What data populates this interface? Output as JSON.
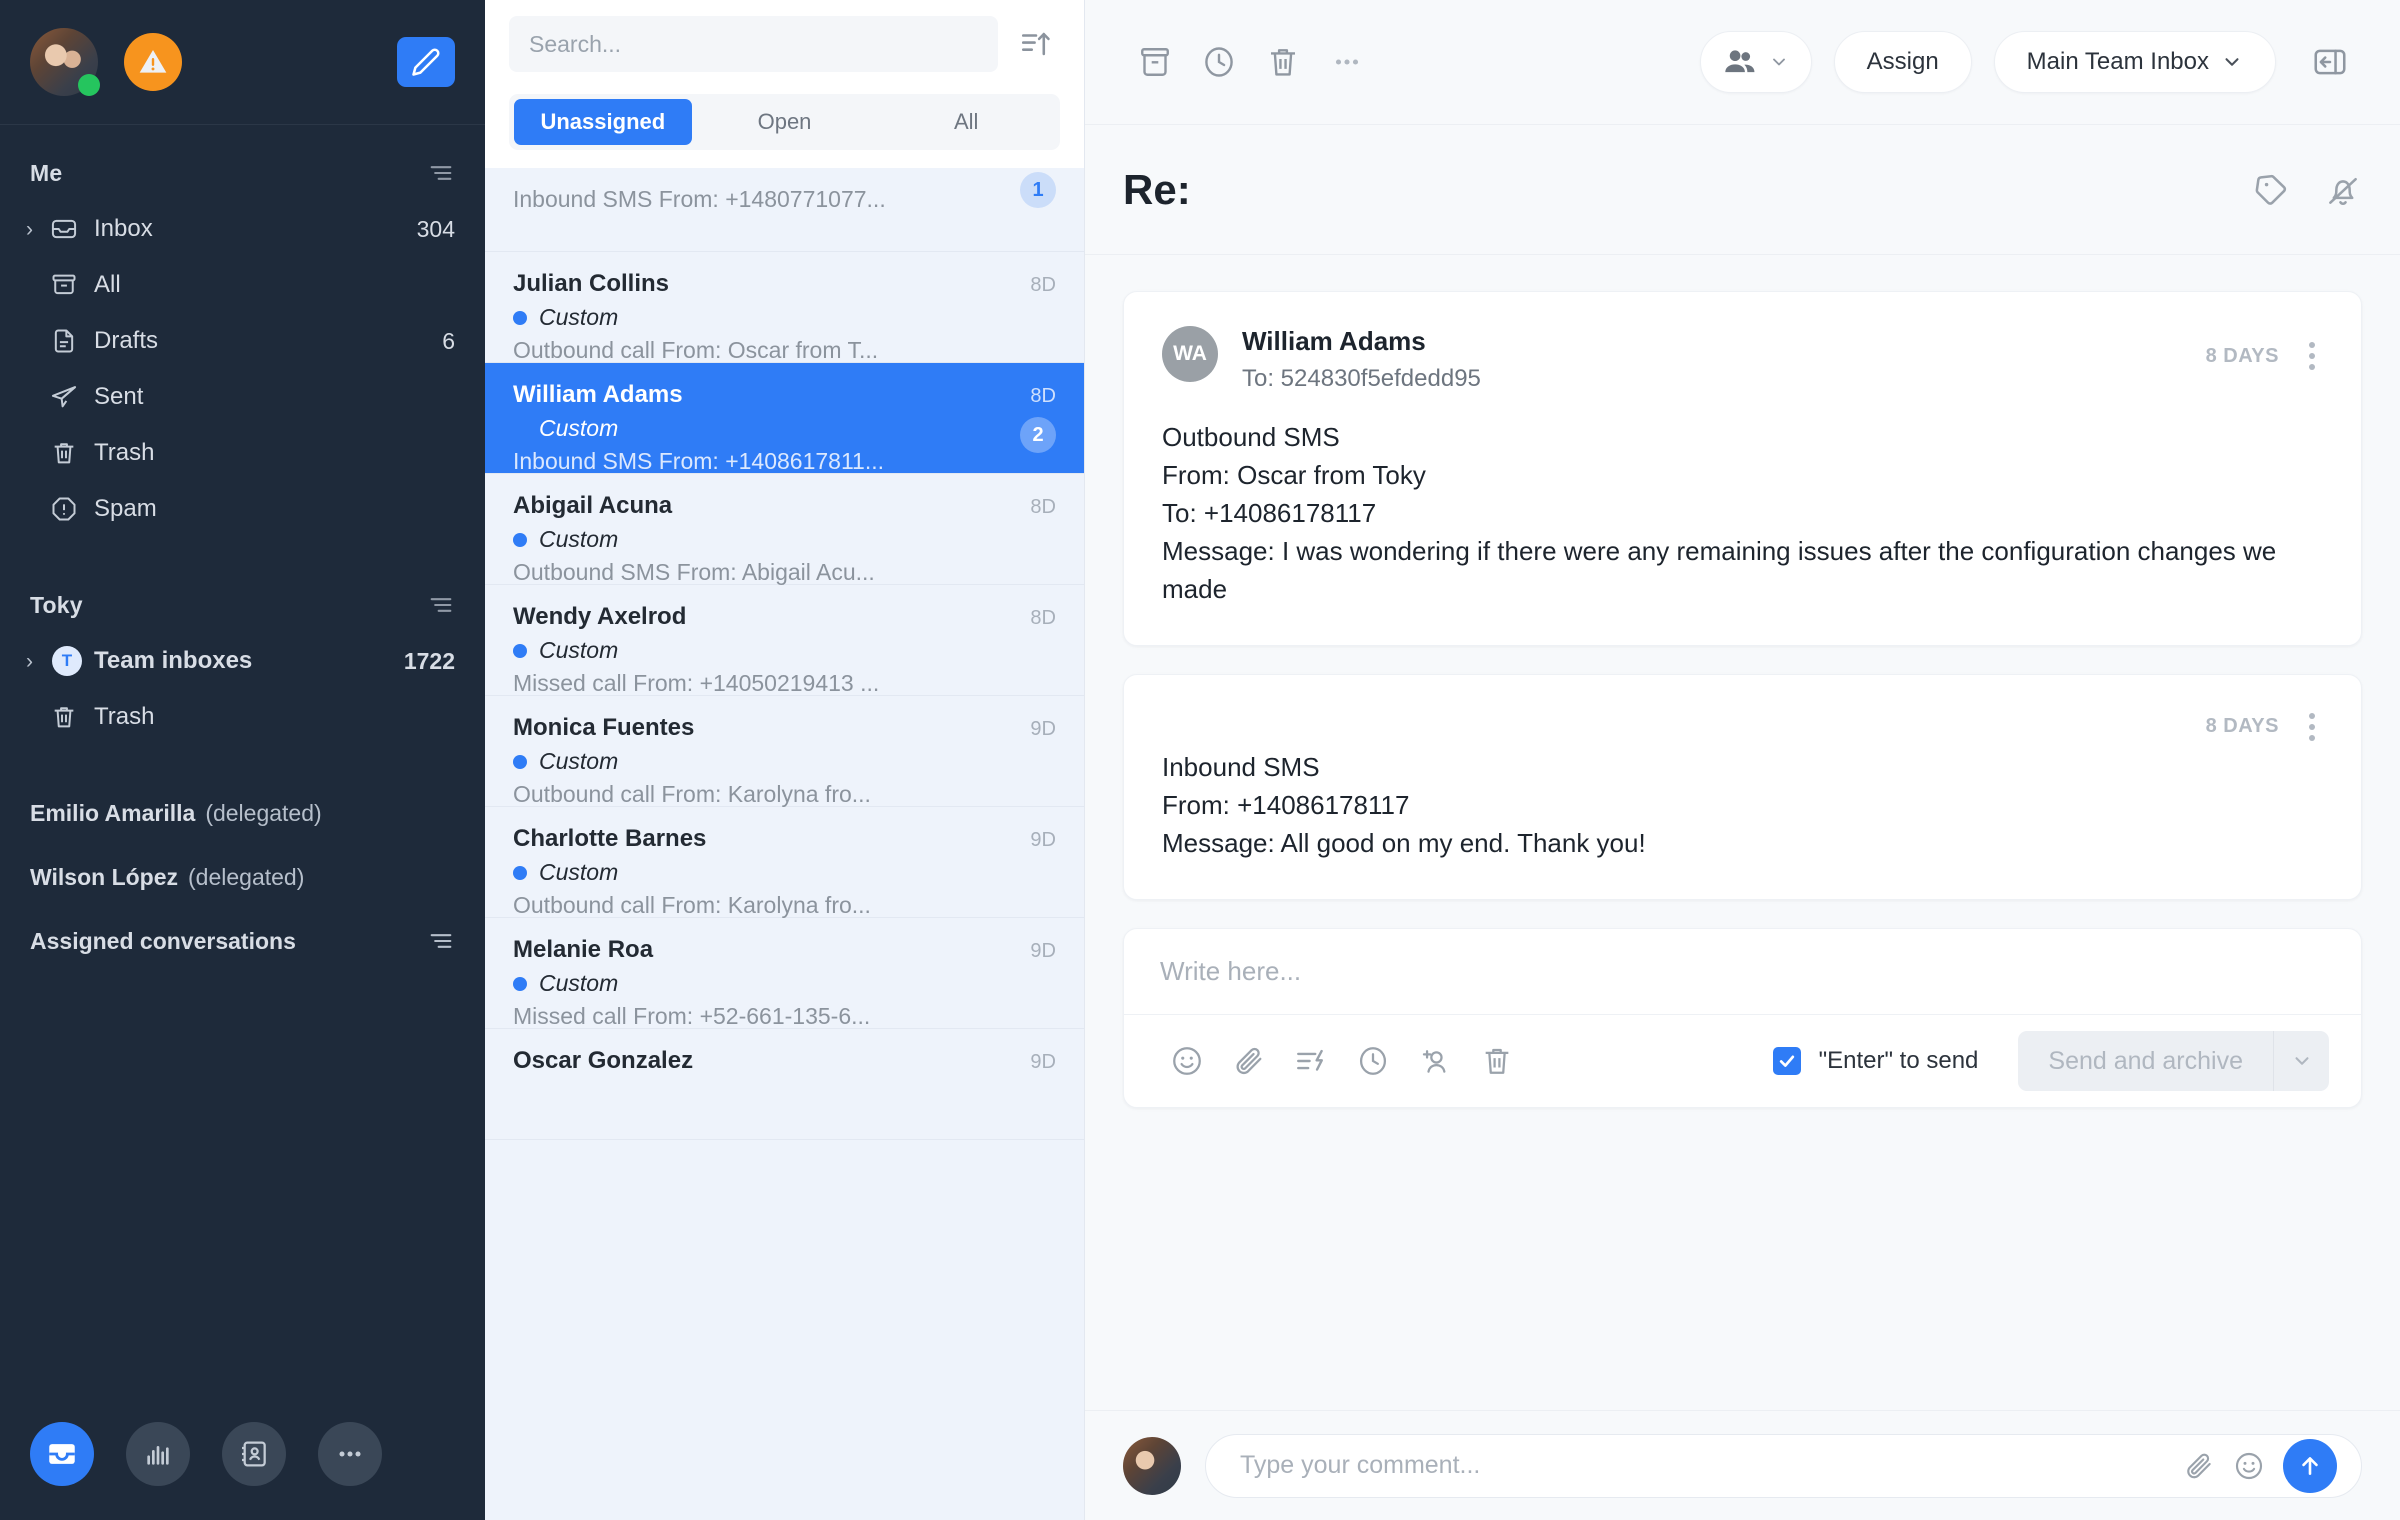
{
  "sidebar": {
    "user_avatar": "user-avatar",
    "status": "online",
    "alert_badge_icon": "warning-triangle-icon",
    "compose_icon": "pencil-icon",
    "sections": [
      {
        "title": "Me",
        "filter_icon": "filter-icon",
        "items": [
          {
            "label": "Inbox",
            "count": "304",
            "icon": "inbox-icon",
            "expandable": true
          },
          {
            "label": "All",
            "count": "",
            "icon": "archive-icon",
            "expandable": false
          },
          {
            "label": "Drafts",
            "count": "6",
            "icon": "document-icon",
            "expandable": false
          },
          {
            "label": "Sent",
            "count": "",
            "icon": "paper-plane-icon",
            "expandable": false
          },
          {
            "label": "Trash",
            "count": "",
            "icon": "trash-icon",
            "expandable": false
          },
          {
            "label": "Spam",
            "count": "",
            "icon": "alert-octagon-icon",
            "expandable": false
          }
        ]
      },
      {
        "title": "Toky",
        "filter_icon": "filter-icon",
        "items": [
          {
            "label": "Team inboxes",
            "count": "1722",
            "icon": "team-avatar-icon",
            "expandable": true,
            "bold": true,
            "badge_letter": "T"
          },
          {
            "label": "Trash",
            "count": "",
            "icon": "trash-icon",
            "expandable": false
          }
        ]
      }
    ],
    "delegated": [
      {
        "name": "Emilio Amarilla",
        "suffix": "(delegated)"
      },
      {
        "name": "Wilson López",
        "suffix": "(delegated)"
      }
    ],
    "assigned_label": "Assigned conversations",
    "assigned_filter_icon": "filter-icon",
    "bottom_nav": [
      {
        "name": "inbox-icon",
        "active": true
      },
      {
        "name": "analytics-icon",
        "active": false
      },
      {
        "name": "contacts-icon",
        "active": false
      },
      {
        "name": "more-icon",
        "active": false
      }
    ]
  },
  "list_panel": {
    "search": {
      "value": "",
      "placeholder": "Search..."
    },
    "sort_icon": "sort-ascending-icon",
    "tabs": [
      {
        "label": "Unassigned",
        "active": true
      },
      {
        "label": "Open",
        "active": false
      },
      {
        "label": "All",
        "active": false
      }
    ],
    "conversations": [
      {
        "partial": true,
        "name": "",
        "age": "",
        "tag": "",
        "preview": "Inbound SMS From: +1480771077...",
        "unread": false,
        "selected": false,
        "count": "1"
      },
      {
        "name": "Julian Collins",
        "age": "8D",
        "tag": "Custom",
        "preview": "Outbound call From: Oscar from T...",
        "unread": true,
        "selected": false,
        "count": ""
      },
      {
        "name": "William Adams",
        "age": "8D",
        "tag": "Custom",
        "preview": "Inbound SMS From: +1408617811...",
        "unread": false,
        "selected": true,
        "count": "2"
      },
      {
        "name": "Abigail Acuna",
        "age": "8D",
        "tag": "Custom",
        "preview": "Outbound SMS From: Abigail Acu...",
        "unread": true,
        "selected": false,
        "count": ""
      },
      {
        "name": "Wendy Axelrod",
        "age": "8D",
        "tag": "Custom",
        "preview": "Missed call From: +14050219413 ...",
        "unread": true,
        "selected": false,
        "count": ""
      },
      {
        "name": "Monica Fuentes",
        "age": "9D",
        "tag": "Custom",
        "preview": "Outbound call From: Karolyna fro...",
        "unread": true,
        "selected": false,
        "count": ""
      },
      {
        "name": "Charlotte Barnes",
        "age": "9D",
        "tag": "Custom",
        "preview": "Outbound call From: Karolyna fro...",
        "unread": true,
        "selected": false,
        "count": ""
      },
      {
        "name": "Melanie Roa",
        "age": "9D",
        "tag": "Custom",
        "preview": "Missed call From: +52-661-135-6...",
        "unread": true,
        "selected": false,
        "count": ""
      },
      {
        "name": "Oscar Gonzalez",
        "age": "9D",
        "tag": "",
        "preview": "",
        "unread": false,
        "selected": false,
        "count": ""
      }
    ]
  },
  "main": {
    "toolbar": {
      "archive_icon": "archive-icon",
      "snooze_icon": "clock-icon",
      "delete_icon": "trash-icon",
      "more_icon": "more-horizontal-icon",
      "participants_icon": "people-icon",
      "assign_label": "Assign",
      "inbox_select_label": "Main Team Inbox",
      "collapse_icon": "collapse-panel-icon"
    },
    "subject": "Re:",
    "subject_icons": {
      "tag_icon": "tag-icon",
      "mute_icon": "bell-off-icon"
    },
    "messages": [
      {
        "avatar_initials": "WA",
        "from": "William Adams",
        "to": "To: 524830f5efdedd95",
        "age": "8 DAYS",
        "body_lines": [
          "Outbound SMS",
          "From: Oscar from Toky",
          "To: +14086178117",
          "Message: I was wondering if there were any remaining issues after the configuration changes we made"
        ]
      },
      {
        "avatar_initials": "",
        "from": "",
        "to": "",
        "age": "8 DAYS",
        "body_lines": [
          "Inbound SMS",
          "From: +14086178117",
          "Message: All good on my end. Thank you!"
        ]
      }
    ],
    "composer": {
      "value": "",
      "placeholder": "Write here...",
      "icons": [
        "emoji-icon",
        "attachment-icon",
        "canned-response-icon",
        "schedule-icon",
        "add-contact-icon",
        "trash-icon"
      ],
      "enter_to_send_label": "\"Enter\" to send",
      "enter_to_send_checked": true,
      "send_label": "Send and archive",
      "send_caret_icon": "chevron-down-icon"
    },
    "comment_bar": {
      "avatar": "user-avatar",
      "value": "",
      "placeholder": "Type your comment...",
      "attachment_icon": "attachment-icon",
      "emoji_icon": "emoji-icon",
      "send_icon": "arrow-up-icon"
    }
  },
  "colors": {
    "sidebar_bg": "#1e2a3a",
    "accent_blue": "#2f7cf6",
    "list_bg": "#eef3fb",
    "alert_orange": "#f7941e",
    "online_green": "#25c55e"
  }
}
